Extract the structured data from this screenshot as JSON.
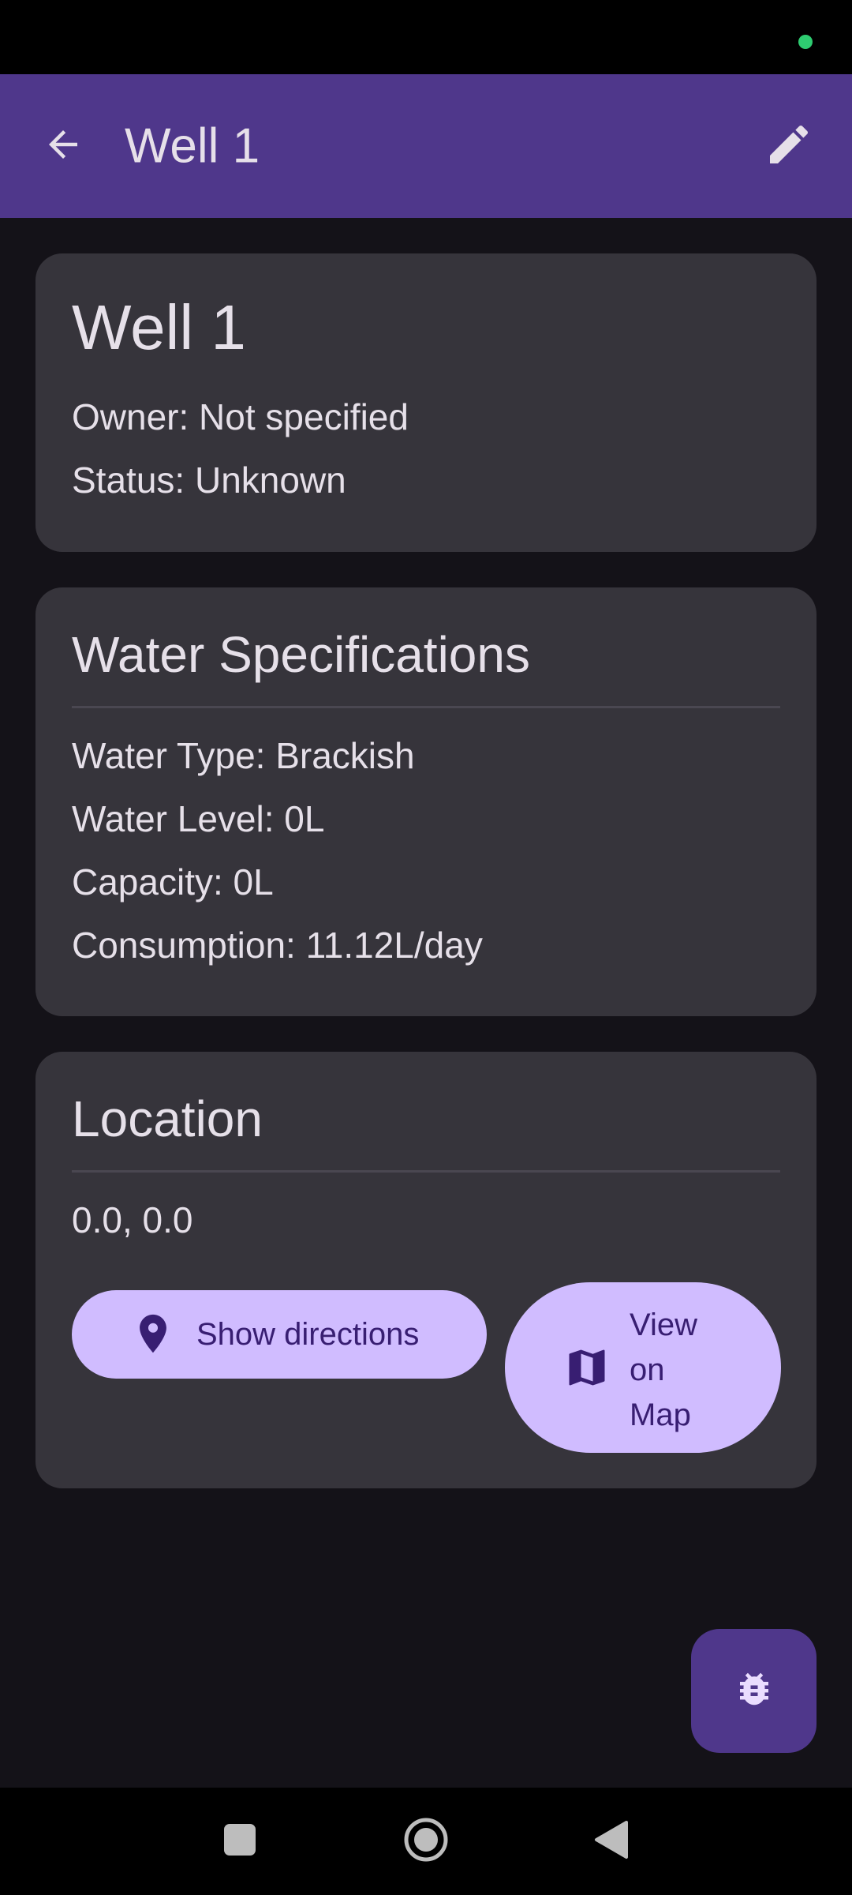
{
  "app_bar": {
    "title": "Well 1",
    "back_icon": "arrow-back-icon",
    "edit_icon": "edit-pencil-icon"
  },
  "well_card": {
    "name": "Well 1",
    "owner": "Owner: Not specified",
    "status": "Status: Unknown"
  },
  "water_specs": {
    "title": "Water Specifications",
    "water_type": "Water Type: Brackish",
    "water_level": "Water Level: 0L",
    "capacity": "Capacity: 0L",
    "consumption": "Consumption: 11.12L/day"
  },
  "location": {
    "title": "Location",
    "coordinates": "0.0, 0.0",
    "directions_button": "Show directions",
    "directions_icon": "location-pin-icon",
    "map_button": "View on Map",
    "map_icon": "map-icon"
  },
  "fab": {
    "icon": "bug-icon"
  },
  "colors": {
    "background": "#141218",
    "app_bar": "#4f378b",
    "card": "#36343b",
    "button": "#d0bcff",
    "button_text": "#381e72",
    "status_dot": "#2ecc71"
  }
}
